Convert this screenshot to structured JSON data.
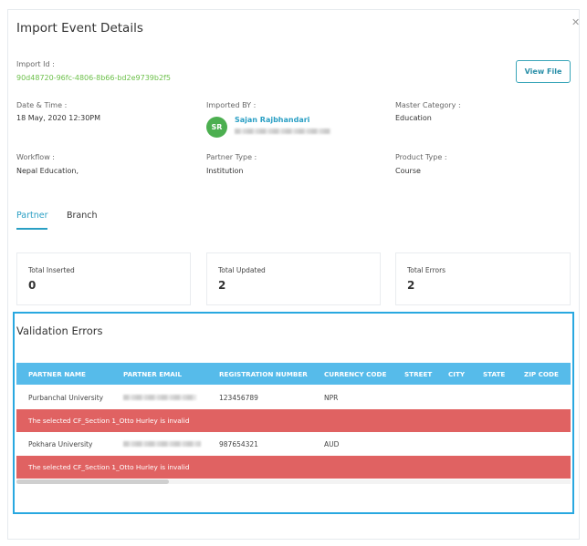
{
  "modal": {
    "title": "Import Event Details",
    "close_icon": "close-icon",
    "view_file_label": "View File",
    "import_id": {
      "label": "Import Id :",
      "value": "90d48720-96fc-4806-8b66-bd2e9739b2f5"
    },
    "date_time": {
      "label": "Date & Time :",
      "value": "18 May, 2020 12:30PM"
    },
    "imported_by": {
      "label": "Imported BY :",
      "initials": "SR",
      "name": "Sajan Rajbhandari"
    },
    "master_category": {
      "label": "Master Category :",
      "value": "Education"
    },
    "workflow": {
      "label": "Workflow :",
      "value": "Nepal Education,"
    },
    "partner_type": {
      "label": "Partner Type :",
      "value": "Institution"
    },
    "product_type": {
      "label": "Product Type :",
      "value": "Course"
    },
    "tabs": [
      {
        "label": "Partner",
        "active": true
      },
      {
        "label": "Branch",
        "active": false
      }
    ],
    "stats": [
      {
        "label": "Total Inserted",
        "value": "0"
      },
      {
        "label": "Total Updated",
        "value": "2"
      },
      {
        "label": "Total Errors",
        "value": "2"
      }
    ],
    "validation": {
      "title": "Validation Errors",
      "columns": [
        "PARTNER NAME",
        "PARTNER EMAIL",
        "REGISTRATION NUMBER",
        "CURRENCY CODE",
        "STREET",
        "CITY",
        "STATE",
        "ZIP CODE"
      ],
      "rows": [
        {
          "partner_name": "Purbanchal University",
          "registration_number": "123456789",
          "currency_code": "NPR",
          "error": "The selected CF_Section 1_Otto Hurley is invalid"
        },
        {
          "partner_name": "Pokhara University",
          "registration_number": "987654321",
          "currency_code": "AUD",
          "error": "The selected CF_Section 1_Otto Hurley is invalid"
        }
      ]
    }
  },
  "colors": {
    "accent": "#2a9fc4",
    "id_green": "#6cc04a",
    "avatar": "#4caf50",
    "table_header": "#56bbea",
    "error_row": "#e06262",
    "box_border": "#29a8e0"
  }
}
